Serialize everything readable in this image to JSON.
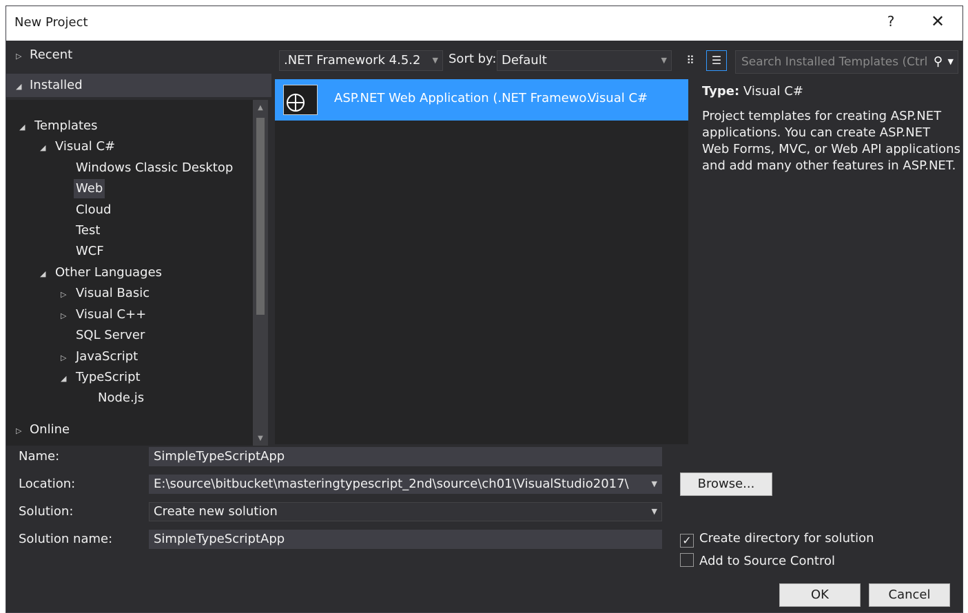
{
  "window": {
    "title": "New Project",
    "help_label": "?",
    "close_label": "✕"
  },
  "tree": {
    "recent": "Recent",
    "installed": "Installed",
    "online": "Online",
    "nodes": [
      {
        "label": "Templates",
        "arrow": "◢"
      },
      {
        "label": "Visual C#",
        "arrow": "◢"
      },
      {
        "label": "Windows Classic Desktop"
      },
      {
        "label": "Web"
      },
      {
        "label": "Cloud"
      },
      {
        "label": "Test"
      },
      {
        "label": "WCF"
      },
      {
        "label": "Other Languages",
        "arrow": "◢"
      },
      {
        "label": "Visual Basic",
        "arrow": "▷"
      },
      {
        "label": "Visual C++",
        "arrow": "▷"
      },
      {
        "label": "SQL Server"
      },
      {
        "label": "JavaScript",
        "arrow": "▷"
      },
      {
        "label": "TypeScript",
        "arrow": "◢"
      },
      {
        "label": "Node.js"
      }
    ]
  },
  "toolbar": {
    "framework": ".NET Framework 4.5.2",
    "sort_label": "Sort by:",
    "sort_value": "Default",
    "search_placeholder": "Search Installed Templates (Ctrl"
  },
  "templates": [
    {
      "name": "ASP.NET Web Application (.NET Framewo...",
      "language": "Visual C#"
    }
  ],
  "info": {
    "type_label": "Type:",
    "type_value": "Visual C#",
    "description": "Project templates for creating ASP.NET applications. You can create ASP.NET Web Forms, MVC, or Web API applications and add many other features in ASP.NET."
  },
  "form": {
    "name_label": "Name:",
    "name_value": "SimpleTypeScriptApp",
    "location_label": "Location:",
    "location_value": "E:\\source\\bitbucket\\masteringtypescript_2nd\\source\\ch01\\VisualStudio2017\\",
    "browse_label": "Browse...",
    "solution_label": "Solution:",
    "solution_value": "Create new solution",
    "solution_name_label": "Solution name:",
    "solution_name_value": "SimpleTypeScriptApp",
    "create_dir_label": "Create directory for solution",
    "create_dir_checked": true,
    "source_control_label": "Add to Source Control",
    "source_control_checked": false,
    "ok_label": "OK",
    "cancel_label": "Cancel"
  },
  "colors": {
    "selection": "#3399ff",
    "background": "#2d2d30",
    "panel": "#252526"
  },
  "icons": {
    "search": "search-icon",
    "tiles_view": "tiles-view-icon",
    "list_view": "list-view-icon",
    "template": "globe-icon"
  }
}
